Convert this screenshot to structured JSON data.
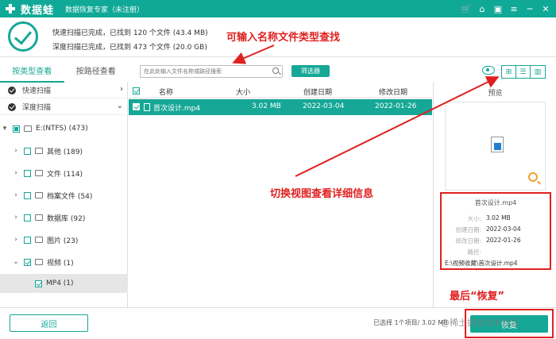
{
  "titlebar": {
    "brand": "数据蛙",
    "app_title": "数据恢复专家（未注册）",
    "icons": [
      "cart-icon",
      "tag-icon",
      "save-icon",
      "menu-icon",
      "minimize-icon",
      "close-icon"
    ],
    "icon_glyphs": [
      "🛒",
      "⌂",
      "▣",
      "≡",
      "─",
      "✕"
    ]
  },
  "summary": {
    "quick_scan": "快速扫描已完成，已找到 120 个文件 (43.4 MB)",
    "deep_scan": "深度扫描已完成，已找到 473 个文件 (20.0 GB)"
  },
  "annotations": {
    "search_hint": "可输入名称文件类型查找",
    "view_hint": "切换视图查看详细信息",
    "recover_hint": "最后“恢复”"
  },
  "tabs": [
    {
      "label": "按类型查看",
      "active": true
    },
    {
      "label": "按路径查看",
      "active": false
    }
  ],
  "toolbar": {
    "search_placeholder": "在此处输入文件名称或路径搜索",
    "filter_label": "筛选器",
    "view_icons": [
      "⊞",
      "☰",
      "▥"
    ]
  },
  "sidebar": {
    "scans": [
      {
        "label": "快速扫描",
        "chevron": "›"
      },
      {
        "label": "深度扫描",
        "chevron": "⌄"
      }
    ],
    "tree": [
      {
        "expander": "▾",
        "label": "E:(NTFS) (473)",
        "check": "partial",
        "level": 0
      },
      {
        "expander": "›",
        "label": "其他 (189)",
        "check": "none",
        "level": 1
      },
      {
        "expander": "›",
        "label": "文件 (114)",
        "check": "none",
        "level": 1
      },
      {
        "expander": "›",
        "label": "档案文件 (54)",
        "check": "none",
        "level": 1
      },
      {
        "expander": "›",
        "label": "数据库 (92)",
        "check": "none",
        "level": 1
      },
      {
        "expander": "›",
        "label": "图片 (23)",
        "check": "none",
        "level": 1
      },
      {
        "expander": "⌄",
        "label": "视频 (1)",
        "check": "checked",
        "level": 1
      },
      {
        "expander": "",
        "label": "MP4 (1)",
        "check": "checked",
        "level": 2,
        "selected": true
      }
    ]
  },
  "table": {
    "headers": {
      "name": "名称",
      "size": "大小",
      "created": "创建日期",
      "modified": "修改日期"
    },
    "rows": [
      {
        "name": "首次设计.mp4",
        "size": "3.02 MB",
        "created": "2022-03-04",
        "modified": "2022-01-26",
        "selected": true
      }
    ]
  },
  "preview": {
    "title": "预览",
    "file_name": "首次设计.mp4",
    "size_label": "大小:",
    "size_value": "3.02 MB",
    "created_label": "创建日期:",
    "created_value": "2022-03-04",
    "modified_label": "修改日期:",
    "modified_value": "2022-01-26",
    "path_label": "路径:",
    "path_value": "E:\\视频收藏\\首次设计.mp4"
  },
  "footer": {
    "back_label": "返回",
    "selected_info": "已选择 1个项目/ 3.02 MB",
    "recover_label": "恢复",
    "watermark": "@稀土掘金技术社区"
  },
  "colors": {
    "accent": "#16a796",
    "annotation": "#e02020"
  }
}
